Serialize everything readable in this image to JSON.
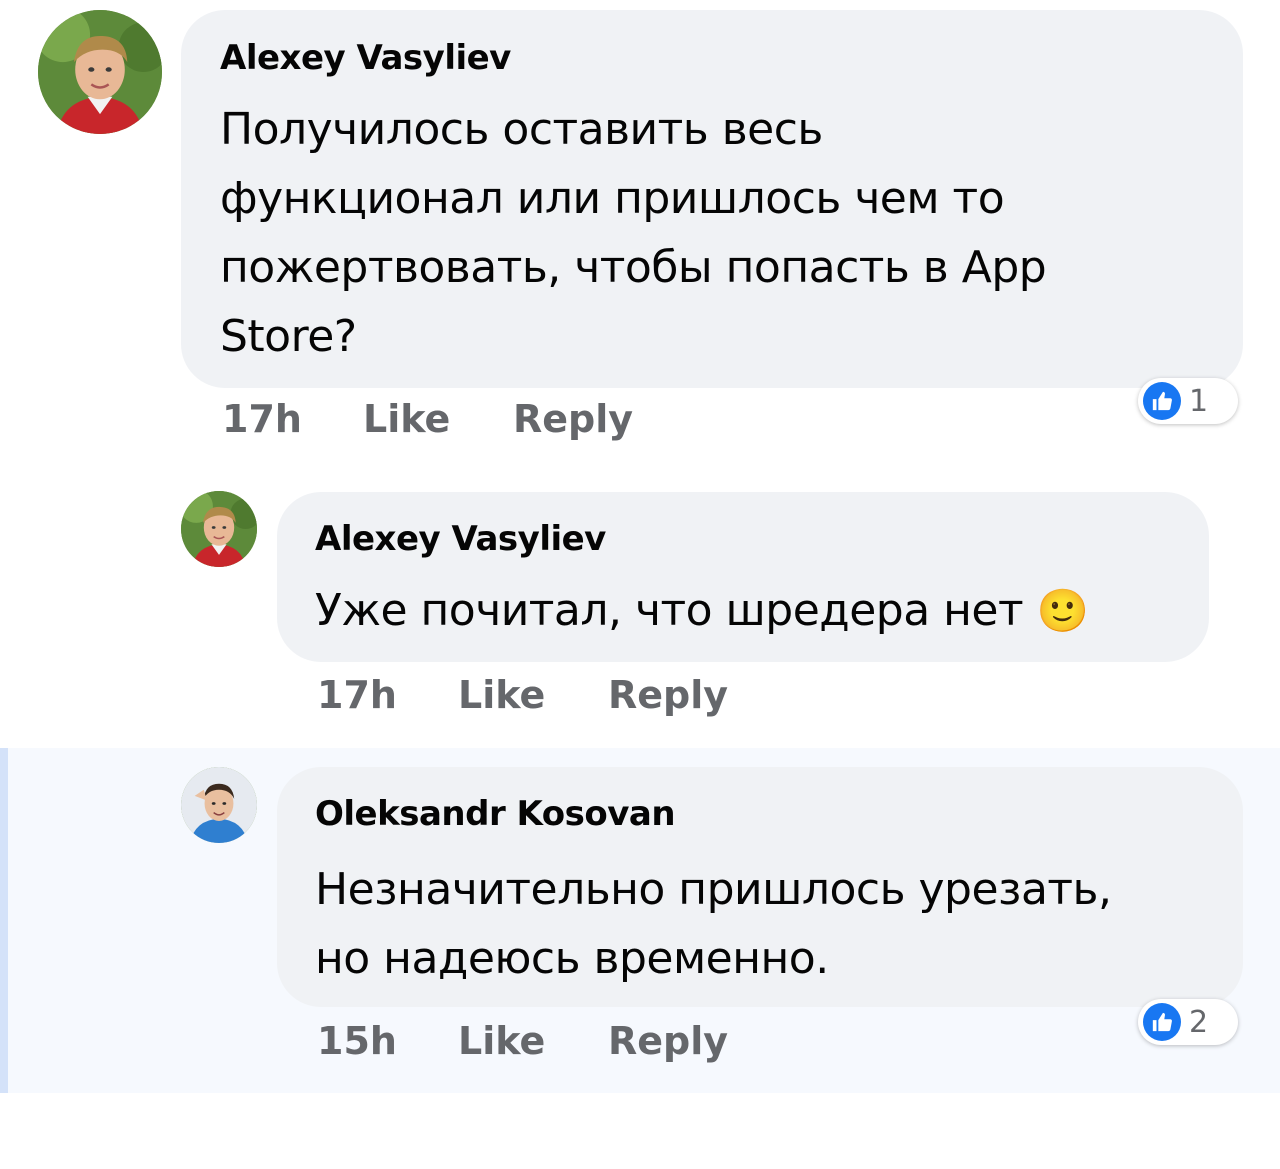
{
  "comments": [
    {
      "author": "Alexey Vasyliev",
      "text_lines": [
        "Получилось оставить весь",
        "функционал или пришлось чем то",
        "пожертвовать, чтобы попасть в App",
        "Store?"
      ],
      "time": "17h",
      "like_label": "Like",
      "reply_label": "Reply",
      "reaction_count": "1",
      "reaction_icon": "thumbs-up-icon"
    },
    {
      "author": "Alexey Vasyliev",
      "text": "Уже почитал, что шредера нет",
      "emoji": "🙂",
      "emoji_icon": "slightly-smiling-face-icon",
      "time": "17h",
      "like_label": "Like",
      "reply_label": "Reply"
    },
    {
      "author": "Oleksandr Kosovan",
      "text_lines": [
        "Незначительно пришлось урезать,",
        "но надеюсь временно."
      ],
      "time": "15h",
      "like_label": "Like",
      "reply_label": "Reply",
      "reaction_count": "2",
      "reaction_icon": "thumbs-up-icon"
    }
  ],
  "colors": {
    "bubble": "#f0f2f5",
    "meta_text": "#65676b",
    "like_blue": "#1877f2",
    "highlight_bg": "#f6f9fe",
    "highlight_bar": "#d4e2f9"
  }
}
